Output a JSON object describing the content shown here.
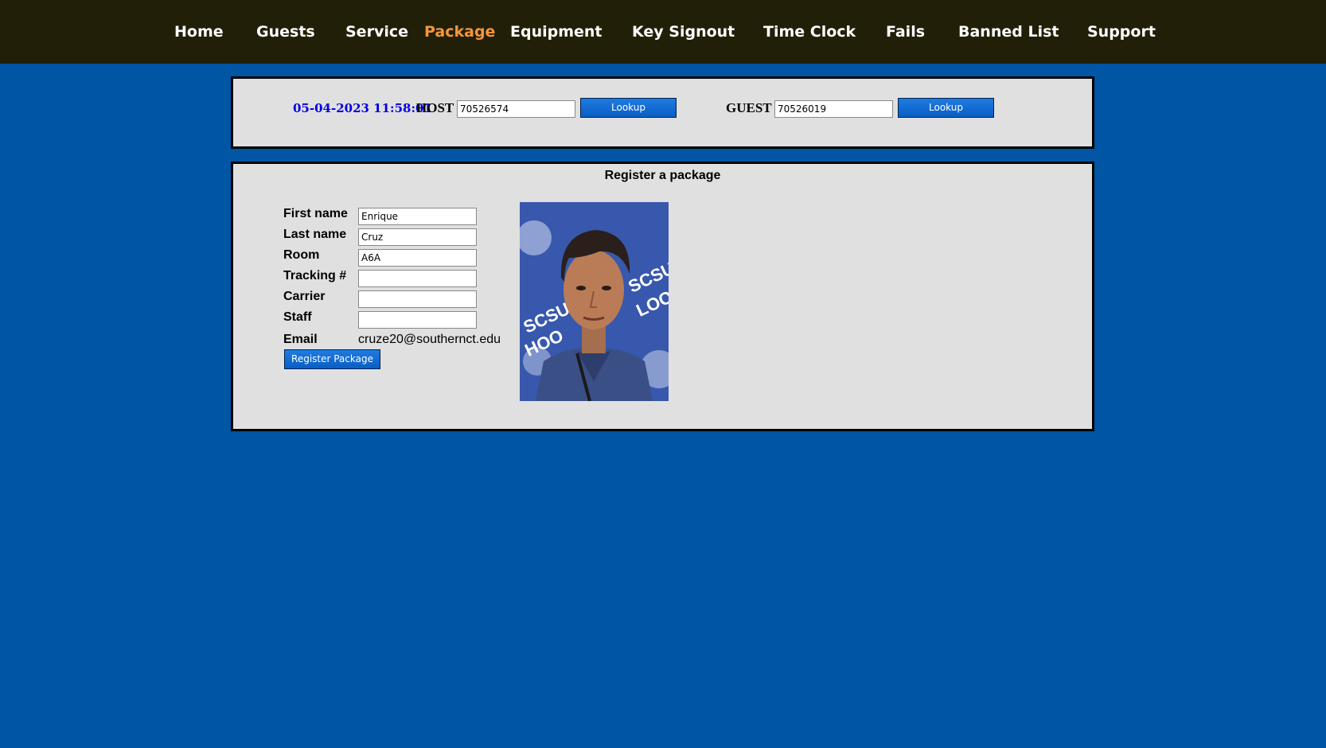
{
  "nav": {
    "items": [
      "Home",
      "Guests",
      "Service",
      "Package",
      "Equipment",
      "Key Signout",
      "Time Clock",
      "Fails",
      "Banned List",
      "Support"
    ],
    "active": "Package"
  },
  "lookup": {
    "datetime": "05-04-2023 11:58:01",
    "host_label": "HOST",
    "host_value": "70526574",
    "host_button": "Lookup",
    "guest_label": "GUEST",
    "guest_value": "70526019",
    "guest_button": "Lookup"
  },
  "register": {
    "title": "Register a package",
    "fields": {
      "first_name": {
        "label": "First name",
        "value": "Enrique"
      },
      "last_name": {
        "label": "Last name",
        "value": "Cruz"
      },
      "room": {
        "label": "Room",
        "value": "A6A"
      },
      "tracking": {
        "label": "Tracking #",
        "value": ""
      },
      "carrier": {
        "label": "Carrier",
        "value": ""
      },
      "staff": {
        "label": "Staff",
        "value": ""
      }
    },
    "email_label": "Email",
    "email_value": "cruze20@southernct.edu",
    "submit_label": "Register Package",
    "photo_backdrop_text": [
      "SCSU",
      "HOO",
      "LOO"
    ]
  },
  "colors": {
    "page_bg": "#0055a5",
    "nav_bg": "#221f08",
    "nav_active": "#f5963c",
    "panel_bg": "#e0e0e0",
    "datetime": "#0000e0",
    "button": "#0a5ec4"
  }
}
